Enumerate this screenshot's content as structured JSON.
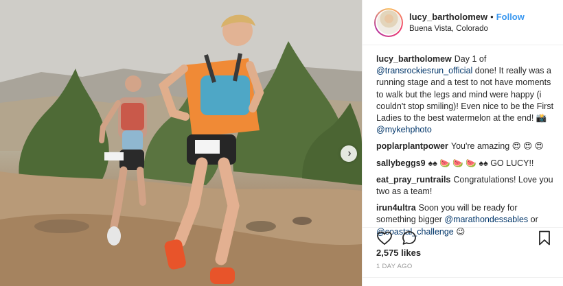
{
  "post": {
    "next_button_glyph": "›"
  },
  "header": {
    "username": "lucy_bartholomew",
    "separator": "•",
    "follow_label": "Follow",
    "location": "Buena Vista, Colorado"
  },
  "caption": {
    "username": "lucy_bartholomew",
    "text_part1": "Day 1 of ",
    "mention1": "@transrockiesrun_official",
    "text_part2": " done! It really was a running stage and a test to not have moments to walk but the legs and mind were happy (i couldn't stop smiling)! Even nice to be the First Ladies to the best watermelon at the end! 📸 ",
    "mention2": "@mykehphoto"
  },
  "comments": [
    {
      "username": "poplarplantpower",
      "text": "You're amazing 😍 😍 😍"
    },
    {
      "username": "sallybeggs9",
      "text": "♠♠ 🍉 🍉 🍉 ♠♠ GO LUCY!!"
    },
    {
      "username": "eat_pray_runtrails",
      "text": "Congratulations! Love you two as a team!"
    }
  ],
  "comment_last": {
    "username": "irun4ultra",
    "text_part1": "Soon you will be ready for something bigger ",
    "mention1": "@marathondessables",
    "text_part2": " or ",
    "mention2": "@coastal_challenge",
    "text_part3": " 😉"
  },
  "actions": {
    "likes": "2,575 likes",
    "time_ago": "1 DAY AGO"
  },
  "colors": {
    "accent": "#3897f0",
    "mention": "#003569",
    "muted": "#999999"
  },
  "icons": [
    "heart-icon",
    "comment-icon",
    "bookmark-icon",
    "chevron-right-icon"
  ]
}
